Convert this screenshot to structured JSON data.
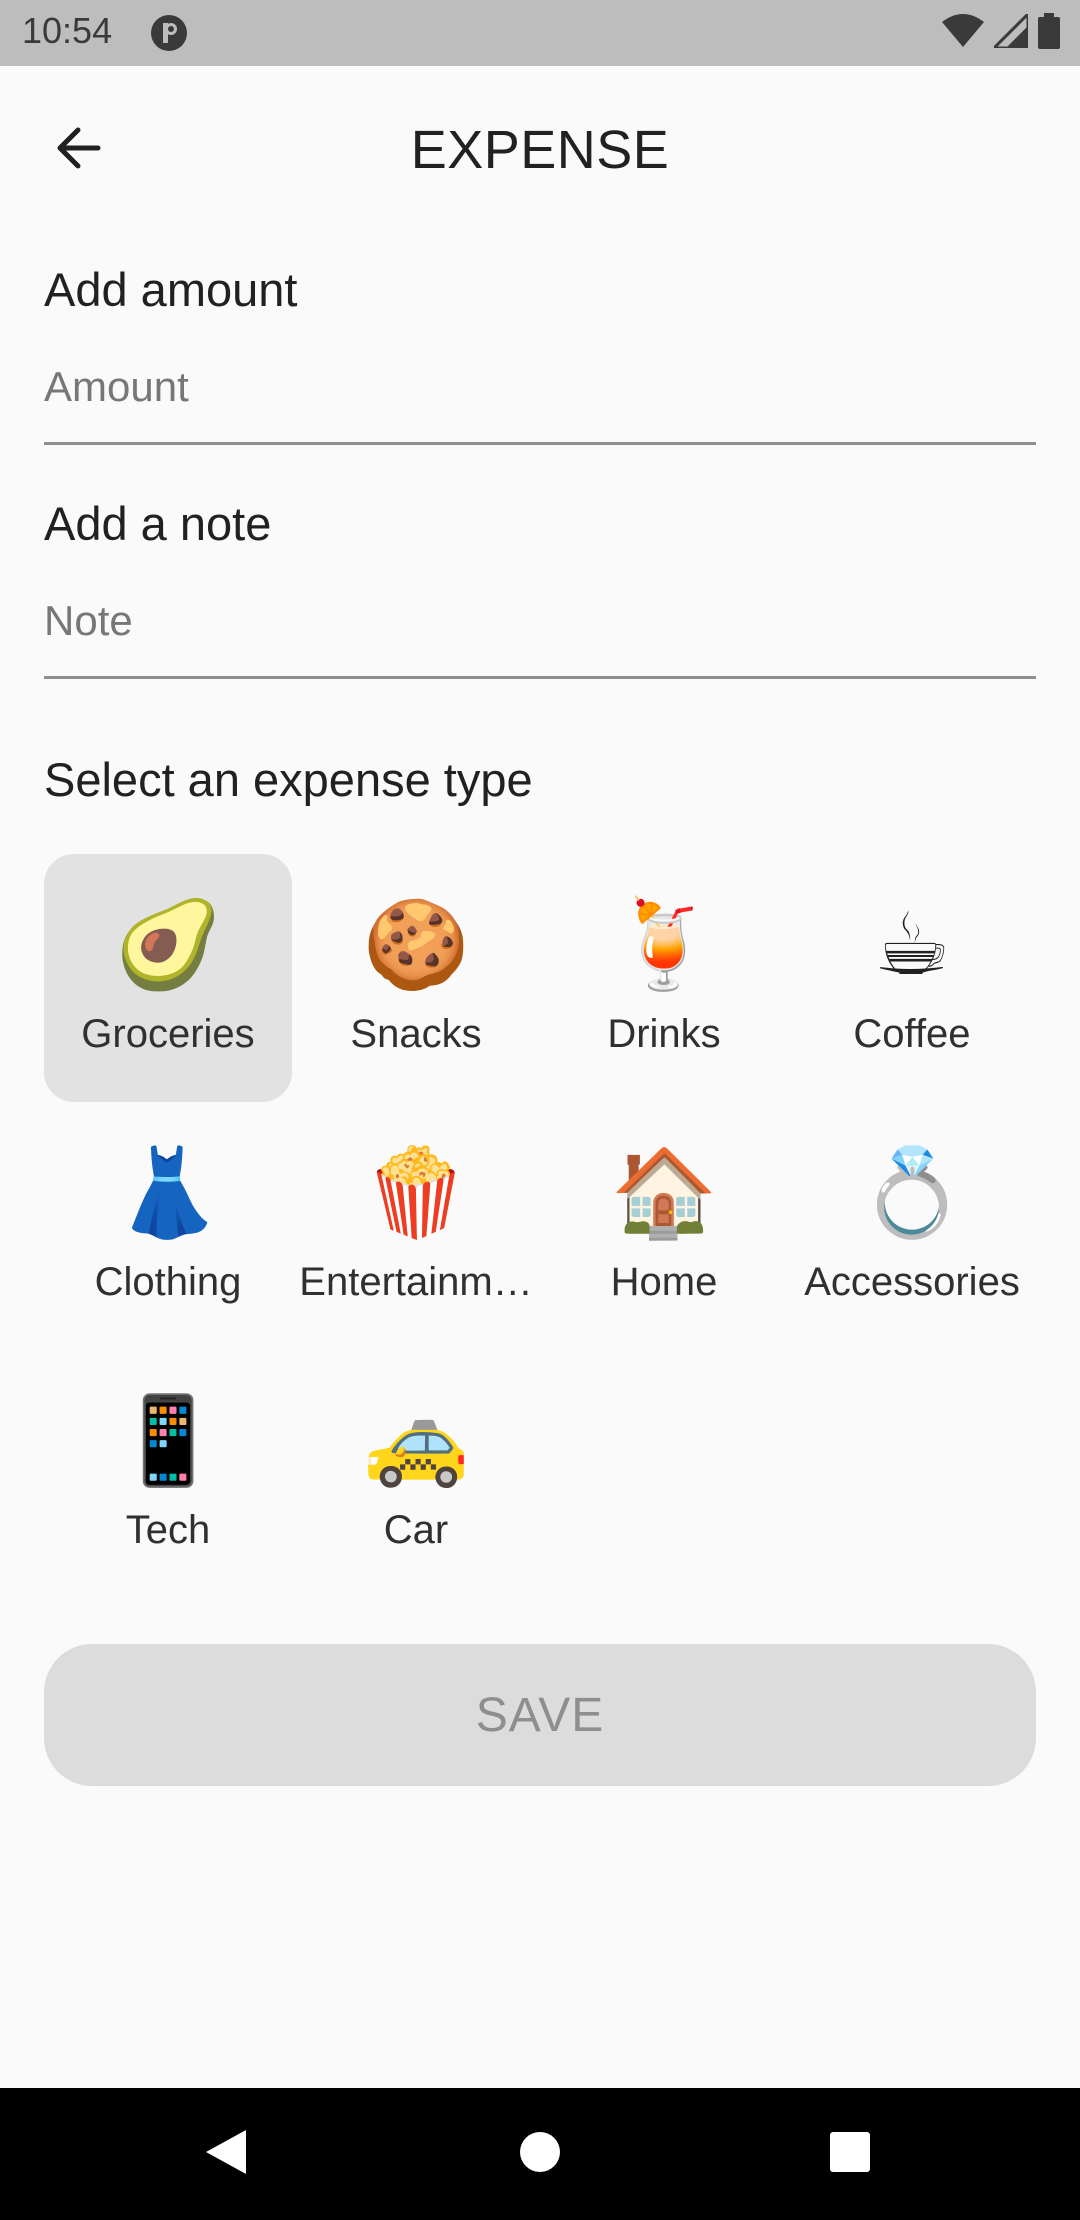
{
  "status_bar": {
    "time": "10:54",
    "icons": [
      "app-notification-icon",
      "wifi-icon",
      "signal-icon",
      "battery-icon"
    ]
  },
  "app_bar": {
    "title": "EXPENSE",
    "back_icon": "arrow-back-icon"
  },
  "amount": {
    "label": "Add amount",
    "placeholder": "Amount",
    "value": ""
  },
  "note": {
    "label": "Add a note",
    "placeholder": "Note",
    "value": ""
  },
  "expense_types": {
    "label": "Select an expense type",
    "selected": "Groceries",
    "items": [
      {
        "label": "Groceries",
        "emoji": "🥑"
      },
      {
        "label": "Snacks",
        "emoji": "🍪"
      },
      {
        "label": "Drinks",
        "emoji": "🍹"
      },
      {
        "label": "Coffee",
        "emoji": "☕"
      },
      {
        "label": "Clothing",
        "emoji": "👗"
      },
      {
        "label": "Entertainm…",
        "emoji": "🍿"
      },
      {
        "label": "Home",
        "emoji": "🏠"
      },
      {
        "label": "Accessories",
        "emoji": "💍"
      },
      {
        "label": "Tech",
        "emoji": "📱"
      },
      {
        "label": "Car",
        "emoji": "🚕"
      }
    ]
  },
  "save_button": {
    "label": "SAVE",
    "enabled": false
  },
  "nav_bar": {
    "buttons": [
      "back-triangle-icon",
      "home-circle-icon",
      "recents-square-icon"
    ]
  },
  "colors": {
    "background": "#fafafa",
    "status_bar": "#bdbdbd",
    "selected_tile": "#e2e2e2",
    "save_button_bg": "#dcdcdc",
    "save_button_text": "#8e8e8e",
    "underline": "#8f8f8f"
  }
}
